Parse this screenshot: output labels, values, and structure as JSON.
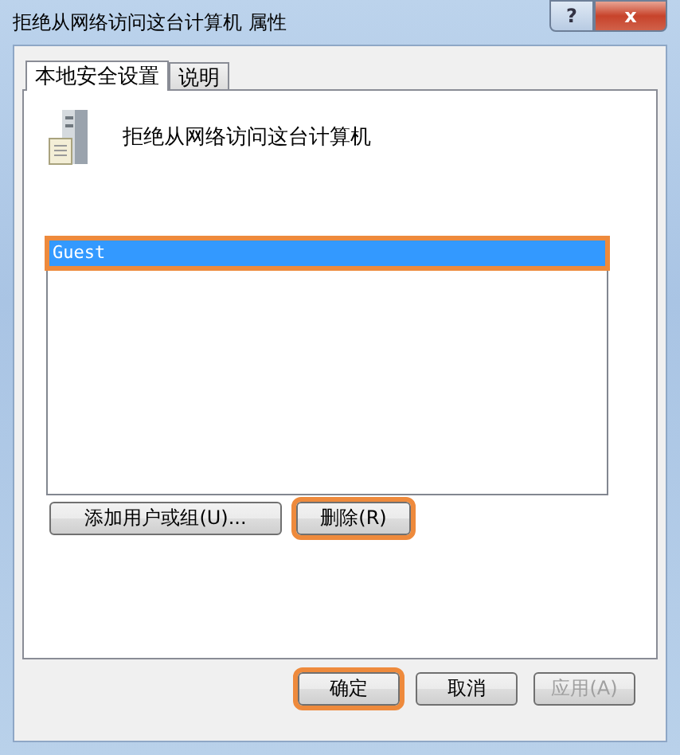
{
  "window": {
    "title": "拒绝从网络访问这台计算机 属性",
    "help": "?",
    "close": "x"
  },
  "tabs": [
    {
      "label": "本地安全设置",
      "selected": true
    },
    {
      "label": "说明",
      "selected": false
    }
  ],
  "policy": {
    "name": "拒绝从网络访问这台计算机"
  },
  "users": [
    {
      "name": "Guest",
      "selected": true,
      "highlighted": true
    }
  ],
  "list_buttons": [
    {
      "label": "添加用户或组(U)...",
      "highlighted": false
    },
    {
      "label": "删除(R)",
      "highlighted": true
    }
  ],
  "dialog_buttons": [
    {
      "label": "确定",
      "highlighted": true,
      "disabled": false
    },
    {
      "label": "取消",
      "highlighted": false,
      "disabled": false
    },
    {
      "label": "应用(A)",
      "highlighted": false,
      "disabled": true
    }
  ]
}
